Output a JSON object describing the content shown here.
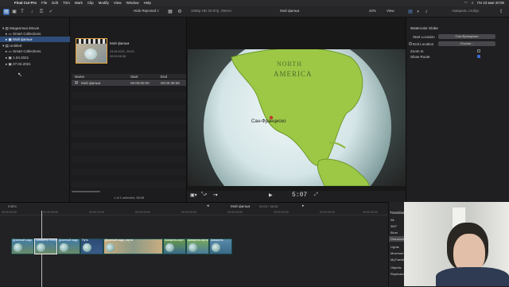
{
  "menubar": {
    "app_name": "Final Cut Pro",
    "menus": [
      "File",
      "Edit",
      "Trim",
      "Mark",
      "Clip",
      "Modify",
      "View",
      "Window",
      "Help"
    ],
    "clock": "Пн 23 мая 20:05"
  },
  "toolbar": {
    "hide_rejected": "Hide Rejected ◊",
    "format": "1080p HD 29.97p, Stereo",
    "project_title": "Мой фильм",
    "zoom": "42%",
    "view": "View",
    "inspector_title": "Акварель глобус"
  },
  "library": {
    "items": [
      {
        "label": "Медиатека iMovie",
        "indent": 0
      },
      {
        "label": "Smart Collections",
        "indent": 1
      },
      {
        "label": "Мой фильм",
        "indent": 1,
        "selected": true
      },
      {
        "label": "Untitled",
        "indent": 0
      },
      {
        "label": "Smart Collections",
        "indent": 1
      },
      {
        "label": "1.04.2021",
        "indent": 1
      },
      {
        "label": "27.04.2021",
        "indent": 1
      }
    ]
  },
  "browser": {
    "clip_name": "Мой фильм",
    "clip_date": "23.05.2021, 20:02",
    "clip_duration": "00:00:08:08",
    "columns": [
      "Name",
      "Start",
      "End"
    ],
    "rows": [
      {
        "name": "Мой фильм",
        "start": "00:00:00:00",
        "end": "00:00:38:08"
      }
    ],
    "footer": "1 of 1 selected, 38:08"
  },
  "viewer": {
    "map_label_1": "NORTH",
    "map_label_2": "AMERICA",
    "city_label": "Сан-Франциско",
    "timecode": "5:07"
  },
  "inspector": {
    "section": "Watercolor Globe",
    "start_location_label": "Start Location",
    "start_location_value": "Сан-Франциско",
    "end_location_label": "End Location",
    "end_location_value": "Choose...",
    "zoom_in_label": "Zoom In",
    "show_route_label": "Show Route"
  },
  "timeline": {
    "index_label": "Index",
    "project_name": "Мой фильм",
    "project_time": "00:00 / 38:08",
    "ruler": [
      "00:00:00:00",
      "00:00:05:00",
      "00:00:10:00",
      "00:00:15:00",
      "00:00:20:00",
      "00:00:25:00",
      "00:00:30:00",
      "00:00:35:00",
      "00:00:40:00"
    ],
    "clips": [
      {
        "label": "Длинный кадр"
      },
      {
        "label": "Акварель глобус"
      },
      {
        "label": "Длинный кадр"
      },
      {
        "label": "Путь"
      },
      {
        "label": "Длинный кадр, карта"
      },
      {
        "label": "Акварель карт"
      },
      {
        "label": "Акварель карта"
      },
      {
        "label": "Акварель"
      }
    ]
  },
  "transitions": {
    "title": "Transitions",
    "items": [
      "All",
      "360°",
      "Blurs",
      "Dissolves",
      "Lights",
      "Movements",
      "MyTransitions",
      "Objects",
      "Replicator/C..."
    ]
  },
  "colors": {
    "accent": "#2f4d7a",
    "land": "#8dbf3c",
    "ocean": "#d8e8ec"
  }
}
